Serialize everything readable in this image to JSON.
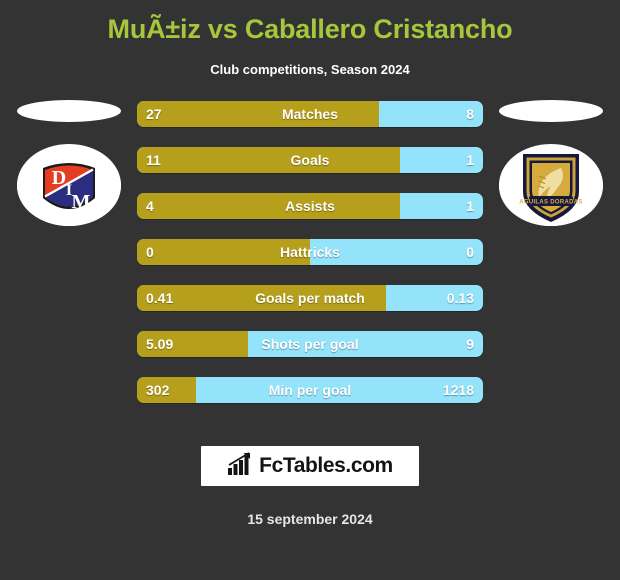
{
  "header": {
    "title": "MuÃ±iz vs Caballero Cristancho",
    "subtitle": "Club competitions, Season 2024",
    "title_color": "#a8c63c"
  },
  "teams": {
    "home": {
      "crest_name": "independiente-medellin-crest",
      "initials_top": "D",
      "initials_mid": "I",
      "initials_bottom": "M"
    },
    "away": {
      "crest_name": "aguilas-doradas-crest",
      "banner_text": "AGUILAS DORADAS"
    }
  },
  "colors": {
    "home_bar": "#b6a01b",
    "away_bar": "#93e3fb",
    "background": "#333333"
  },
  "chart_data": {
    "type": "bar",
    "title": "MuÃ±iz vs Caballero Cristancho",
    "subtitle": "Club competitions, Season 2024",
    "orientation": "horizontal-diverging",
    "categories": [
      "Matches",
      "Goals",
      "Assists",
      "Hattricks",
      "Goals per match",
      "Shots per goal",
      "Min per goal"
    ],
    "series": [
      {
        "name": "MuÃ±iz",
        "color": "#b6a01b",
        "values": [
          27,
          11,
          4,
          0,
          0.41,
          5.09,
          302
        ]
      },
      {
        "name": "Caballero Cristancho",
        "color": "#93e3fb",
        "values": [
          8,
          1,
          1,
          0,
          0.13,
          9,
          1218
        ]
      }
    ],
    "grid": false,
    "legend": "none"
  },
  "rows": [
    {
      "label": "Matches",
      "home": "27",
      "away": "8",
      "fill_pct": 70.0
    },
    {
      "label": "Goals",
      "home": "11",
      "away": "1",
      "fill_pct": 76.0
    },
    {
      "label": "Assists",
      "home": "4",
      "away": "1",
      "fill_pct": 76.0
    },
    {
      "label": "Hattricks",
      "home": "0",
      "away": "0",
      "fill_pct": 50.0
    },
    {
      "label": "Goals per match",
      "home": "0.41",
      "away": "0.13",
      "fill_pct": 72.0
    },
    {
      "label": "Shots per goal",
      "home": "5.09",
      "away": "9",
      "fill_pct": 32.0
    },
    {
      "label": "Min per goal",
      "home": "302",
      "away": "1218",
      "fill_pct": 17.0
    }
  ],
  "footer": {
    "brand_icon": "bar-chart-growth-icon",
    "brand": "FcTables.com",
    "date": "15 september 2024"
  }
}
